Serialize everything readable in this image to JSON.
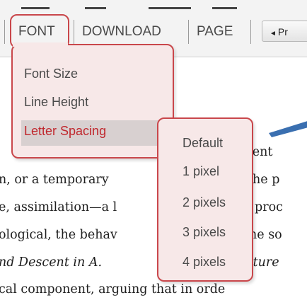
{
  "toolbar": {
    "tabs": [
      "FONT",
      "DOWNLOAD",
      "PAGE"
    ],
    "prev_label": "Pr",
    "prev_arrow": "◄"
  },
  "font_menu": {
    "items": [
      "Font Size",
      "Line Height",
      "Letter Spacing"
    ],
    "active_index": 2
  },
  "spacing_menu": {
    "items": [
      "Default",
      "1 pixel",
      "2 pixels",
      "3 pixels",
      "4 pixels"
    ]
  },
  "body_text": {
    "line1_right": "ident",
    "line2_left": "n, or a temporary",
    "line2_right": "the p",
    "line3_left": "e, assimilation—a l",
    "line3_right": "proc",
    "line4_left": "ological, the behav",
    "line4_right": "he so",
    "line5_left": "nd Descent in A.",
    "line5_right": "lture",
    "line6": "cal component, arguing that in orde"
  },
  "colors": {
    "accent": "#c9474b",
    "menu_bg": "#f7e8e8",
    "active_text": "#c0272d",
    "arrow_blue": "#3a6fb0"
  }
}
